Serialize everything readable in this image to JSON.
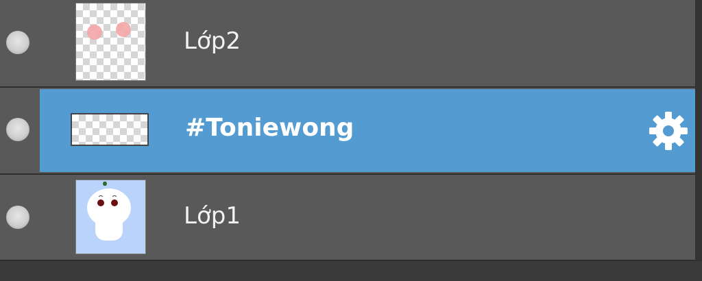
{
  "layers": [
    {
      "name": "Lớp2",
      "visible": true,
      "selected": false,
      "thumbnail": "pink-cheeks-on-transparent"
    },
    {
      "name": "#Toniewong",
      "visible": true,
      "selected": true,
      "thumbnail": "transparent-text-layer",
      "settings_icon": "gear-icon"
    },
    {
      "name": "Lớp1",
      "visible": true,
      "selected": false,
      "thumbnail": "white-ghost-on-light-blue"
    }
  ],
  "colors": {
    "row_bg": "#595959",
    "selected_bg": "#539bd0",
    "text": "#f2f2f2"
  }
}
